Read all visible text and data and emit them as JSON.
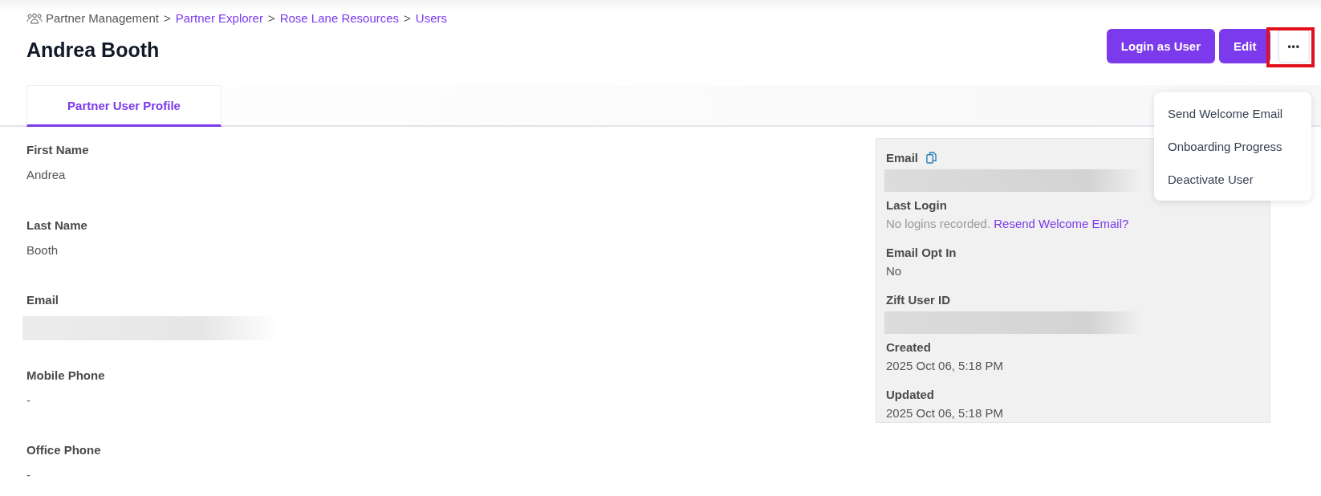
{
  "breadcrumb": [
    {
      "label": "Partner Management",
      "link": false
    },
    {
      "label": "Partner Explorer",
      "link": true
    },
    {
      "label": "Rose Lane Resources",
      "link": true
    },
    {
      "label": "Users",
      "link": true
    }
  ],
  "breadcrumb_separator": ">",
  "title": "Andrea Booth",
  "actions": [
    {
      "label": "Login as User",
      "kind": "primary"
    },
    {
      "label": "Edit",
      "kind": "primary"
    },
    {
      "label": "•••",
      "kind": "more"
    }
  ],
  "menu": [
    {
      "label": "Send Welcome Email"
    },
    {
      "label": "Onboarding Progress"
    },
    {
      "label": "Deactivate User"
    }
  ],
  "tabs": [
    {
      "label": "Partner User Profile",
      "selected": true
    }
  ],
  "profile_fields": [
    {
      "label": "First Name",
      "kind": "text",
      "value": "Andrea"
    },
    {
      "label": "Last Name",
      "kind": "text",
      "value": "Booth"
    },
    {
      "label": "Email",
      "kind": "redacted"
    },
    {
      "label": "Mobile Phone",
      "kind": "text",
      "value": "-"
    },
    {
      "label": "Office Phone",
      "kind": "text",
      "value": "-"
    }
  ],
  "summary_fields": [
    {
      "label": "Email",
      "kind": "redacted",
      "copyable": true
    },
    {
      "label": "Last Login",
      "kind": "note",
      "value": "No logins recorded.",
      "link": "Resend Welcome Email?"
    },
    {
      "label": "Email Opt In",
      "kind": "text",
      "value": "No"
    },
    {
      "label": "Zift User ID",
      "kind": "redacted"
    },
    {
      "label": "Created",
      "kind": "text",
      "value": "2025 Oct 06, 5:18 PM"
    },
    {
      "label": "Updated",
      "kind": "text",
      "value": "2025 Oct 06, 5:18 PM"
    }
  ]
}
